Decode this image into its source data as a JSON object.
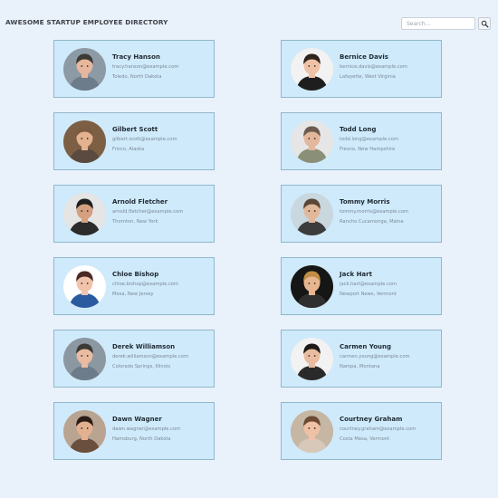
{
  "header": {
    "title": "AWESOME STARTUP EMPLOYEE DIRECTORY",
    "search_placeholder": "Search...",
    "search_icon": "search-icon"
  },
  "employees": [
    {
      "name": "Tracy Hanson",
      "email": "tracy.hanson@example.com",
      "location": "Toledo, North Dakota",
      "avatar": {
        "bg": "#8c9aa6",
        "hair": "#3d3a35",
        "skin": "#e7b79d",
        "shirt": "#6d7c8a"
      }
    },
    {
      "name": "Bernice Davis",
      "email": "bernice.davis@example.com",
      "location": "Lafayette, West Virginia",
      "avatar": {
        "bg": "#f2f2f2",
        "hair": "#2f241d",
        "skin": "#efc2a7",
        "shirt": "#1e1e1e"
      }
    },
    {
      "name": "Gilbert Scott",
      "email": "gilbert.scott@example.com",
      "location": "Frisco, Alaska",
      "avatar": {
        "bg": "#7d5f44",
        "hair": "#7b5b42",
        "skin": "#e3b28f",
        "shirt": "#5a4a40"
      }
    },
    {
      "name": "Todd Long",
      "email": "todd.long@example.com",
      "location": "Fresno, New Hampshire",
      "avatar": {
        "bg": "#e6e6e6",
        "hair": "#6c5c4f",
        "skin": "#e3b79b",
        "shirt": "#8a8f78"
      }
    },
    {
      "name": "Arnold Fletcher",
      "email": "arnold.fletcher@example.com",
      "location": "Thornton, New York",
      "avatar": {
        "bg": "#e5e5e5",
        "hair": "#1f1f1f",
        "skin": "#d4a07f",
        "shirt": "#2b2b2b"
      }
    },
    {
      "name": "Tommy Morris",
      "email": "tommy.morris@example.com",
      "location": "Rancho Cucamonga, Maine",
      "avatar": {
        "bg": "#c9d7df",
        "hair": "#5a4636",
        "skin": "#e2b89a",
        "shirt": "#3c3c3c"
      }
    },
    {
      "name": "Chloe Bishop",
      "email": "chloe.bishop@example.com",
      "location": "Mesa, New Jersey",
      "avatar": {
        "bg": "#ffffff",
        "hair": "#4a2a24",
        "skin": "#f1c3aa",
        "shirt": "#2b5aa0"
      }
    },
    {
      "name": "Jack Hart",
      "email": "jack.hart@example.com",
      "location": "Newport News, Vermont",
      "avatar": {
        "bg": "#161616",
        "hair": "#c18d45",
        "skin": "#e7b58f",
        "shirt": "#2f2f2f"
      }
    },
    {
      "name": "Derek Williamson",
      "email": "derek.williamson@example.com",
      "location": "Colorado Springs, Illinois",
      "avatar": {
        "bg": "#8b98a2",
        "hair": "#3d3a35",
        "skin": "#e9bba1",
        "shirt": "#6d7c8a"
      }
    },
    {
      "name": "Carmen Young",
      "email": "carmen.young@example.com",
      "location": "Nampa, Montana",
      "avatar": {
        "bg": "#f2f2f2",
        "hair": "#1f1a18",
        "skin": "#e9bca1",
        "shirt": "#2a2a2a"
      }
    },
    {
      "name": "Dawn Wagner",
      "email": "dawn.wagner@example.com",
      "location": "Hamsburg, North Dakota",
      "avatar": {
        "bg": "#b9a391",
        "hair": "#2a1c17",
        "skin": "#e3b18f",
        "shirt": "#6a4f3e"
      }
    },
    {
      "name": "Courtney Graham",
      "email": "courtney.graham@example.com",
      "location": "Costa Mesa, Vermont",
      "avatar": {
        "bg": "#c6b6a4",
        "hair": "#6b4a34",
        "skin": "#efc1a5",
        "shirt": "#d7c8b9"
      }
    }
  ]
}
